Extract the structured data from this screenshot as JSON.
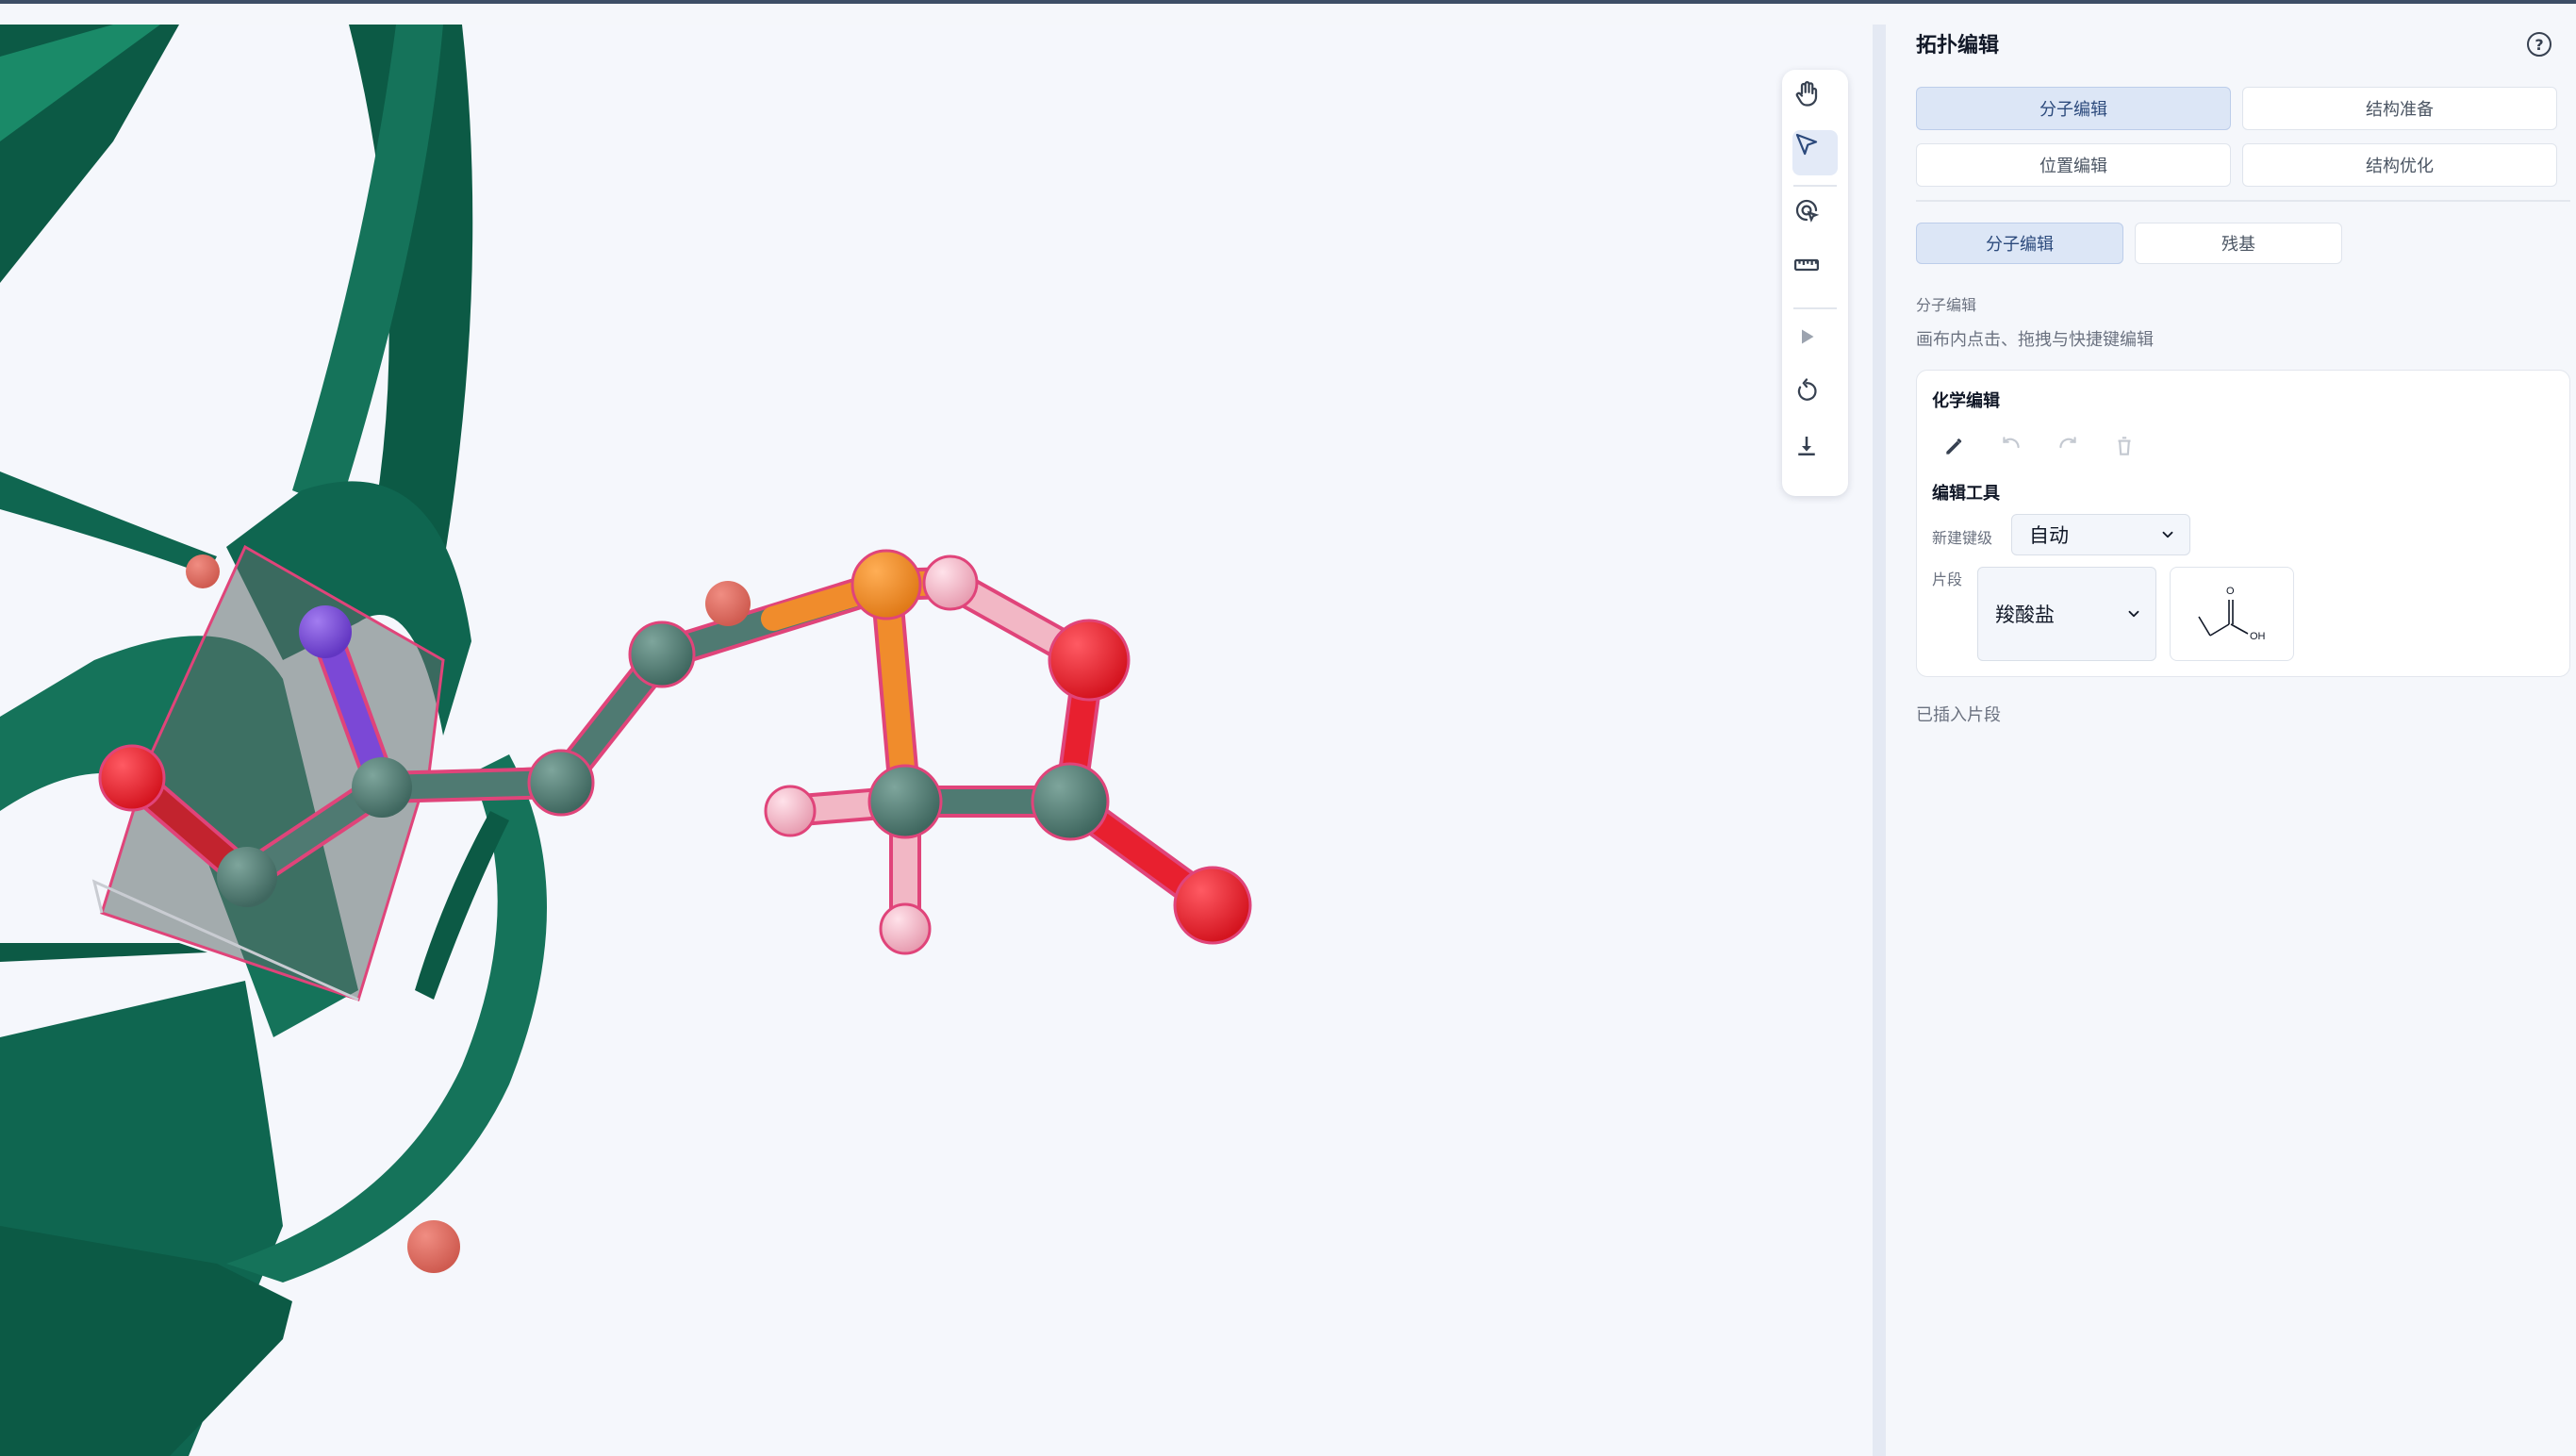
{
  "panel": {
    "title": "拓扑编辑",
    "help_symbol": "?",
    "main_tabs": [
      {
        "label": "分子编辑",
        "active": true
      },
      {
        "label": "结构准备",
        "active": false
      },
      {
        "label": "位置编辑",
        "active": false
      },
      {
        "label": "结构优化",
        "active": false
      }
    ],
    "sub_tabs": [
      {
        "label": "分子编辑",
        "active": true
      },
      {
        "label": "残基",
        "active": false
      }
    ],
    "section_label": "分子编辑",
    "section_hint": "画布内点击、拖拽与快捷键编辑",
    "chem_card": {
      "title": "化学编辑",
      "actions": [
        "pencil-icon",
        "undo-icon",
        "redo-icon",
        "trash-icon"
      ],
      "tools_title": "编辑工具",
      "bond_level_label": "新建键级",
      "bond_level_value": "自动",
      "fragment_label": "片段",
      "fragment_value": "羧酸盐",
      "fragment_preview_labels": {
        "o": "O",
        "oh": "OH"
      }
    },
    "inserted_label": "已插入片段"
  },
  "toolbar": {
    "tools": [
      "hand-icon",
      "pointer-icon",
      "focus-select-icon",
      "ruler-icon",
      "play-icon",
      "reset-icon",
      "download-icon"
    ],
    "active_tool": "pointer-icon"
  },
  "colors": {
    "ribbon": "#15735a",
    "ribbon_dark": "#0c5a45",
    "carbon": "#4f7a72",
    "oxygen": "#e8202f",
    "sulfur": "#f08c2c",
    "hydrogen": "#f2b7c5",
    "nitrogen": "#7b48d6",
    "selection": "#e0447a",
    "accent": "#2c4a7c"
  }
}
